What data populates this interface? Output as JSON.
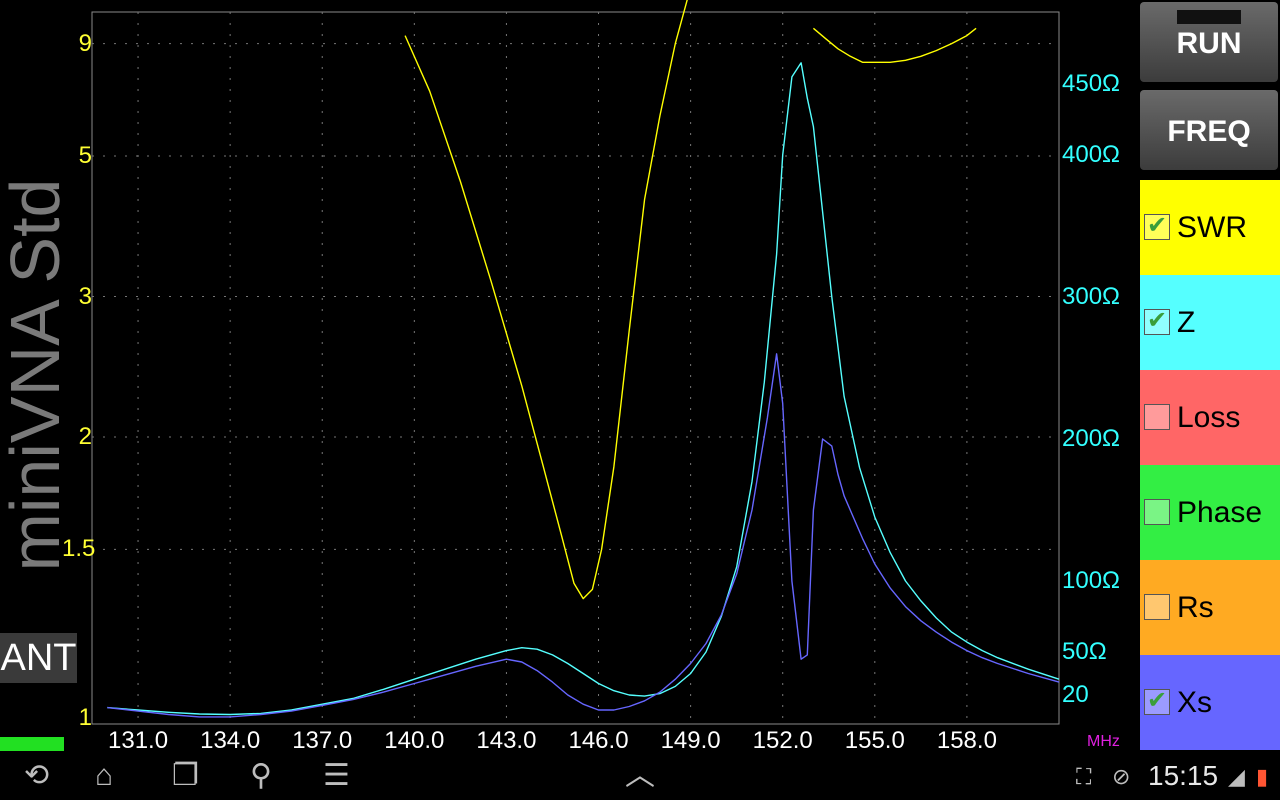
{
  "app_title": "miniVNA Std",
  "mode_label": "ANT",
  "buttons": {
    "run": "RUN",
    "freq": "FREQ"
  },
  "traces": [
    {
      "name": "SWR",
      "checked": true,
      "color": "#ffff00"
    },
    {
      "name": "Z",
      "checked": true,
      "color": "#55ffff"
    },
    {
      "name": "Loss",
      "checked": false,
      "color": "#ff6666"
    },
    {
      "name": "Phase",
      "checked": false,
      "color": "#33ee44"
    },
    {
      "name": "Rs",
      "checked": false,
      "color": "#ffaa22"
    },
    {
      "name": "Xs",
      "checked": true,
      "color": "#6666ff"
    }
  ],
  "status_bar": {
    "time": "15:15"
  },
  "chart_data": {
    "type": "line",
    "x_unit_label": "MHz",
    "xlim": [
      129.5,
      161.0
    ],
    "x_ticks": [
      "131.0",
      "134.0",
      "137.0",
      "140.0",
      "143.0",
      "146.0",
      "149.0",
      "152.0",
      "155.0",
      "158.0"
    ],
    "left_axis": {
      "scale": "swr",
      "ticks": [
        "9",
        "5",
        "3",
        "2",
        "1.5",
        "1"
      ],
      "color": "#ffff33"
    },
    "right_axis": {
      "ticks": [
        "450Ω",
        "400Ω",
        "300Ω",
        "200Ω",
        "100Ω",
        "50Ω",
        "20"
      ],
      "color": "#33ffff"
    },
    "grid": true,
    "series": [
      {
        "name": "SWR",
        "axis": "left",
        "color": "#ffff00",
        "x": [
          139.7,
          140.5,
          141.5,
          142.5,
          143.5,
          144.2,
          144.8,
          145.2,
          145.5,
          145.8,
          146.1,
          146.5,
          147.0,
          147.5,
          148.0,
          148.5,
          149.0,
          149.4,
          149.8,
          150.0
        ],
        "y": [
          9.5,
          6.8,
          4.5,
          3.15,
          2.3,
          1.85,
          1.55,
          1.38,
          1.33,
          1.36,
          1.5,
          1.85,
          2.7,
          4.2,
          6.0,
          9.0,
          14,
          22,
          40,
          60
        ]
      },
      {
        "name": "SWR",
        "axis": "left",
        "color": "#ffff00",
        "x": [
          153.0,
          153.4,
          153.8,
          154.2,
          154.6,
          155.0,
          155.5,
          156.0,
          156.5,
          157.0,
          157.5,
          158.0,
          158.3
        ],
        "y": [
          10,
          9.3,
          8.7,
          8.3,
          8.0,
          8.0,
          8.0,
          8.1,
          8.3,
          8.6,
          9.0,
          9.5,
          10
        ]
      },
      {
        "name": "Z",
        "axis": "right",
        "color": "#55ffff",
        "x": [
          130,
          131,
          132,
          133,
          134,
          135,
          136,
          137,
          138,
          139,
          140,
          141,
          142,
          143,
          143.5,
          144,
          144.5,
          145,
          145.5,
          146,
          146.5,
          147,
          147.5,
          148,
          148.5,
          149,
          149.5,
          150,
          150.5,
          151,
          151.4,
          151.8,
          152.0,
          152.3,
          152.6,
          152.8,
          153.0,
          153.3,
          153.6,
          154.0,
          154.5,
          155.0,
          155.5,
          156.0,
          156.5,
          157.0,
          157.5,
          158.0,
          158.5,
          159.0,
          160.0,
          161.0
        ],
        "y": [
          9,
          7,
          5,
          3.5,
          3,
          4,
          7,
          12,
          17,
          24,
          31,
          38,
          45,
          51,
          53,
          52,
          48,
          42,
          35,
          28,
          23,
          20,
          19,
          21,
          26,
          35,
          50,
          75,
          110,
          170,
          240,
          330,
          400,
          455,
          465,
          440,
          420,
          360,
          300,
          230,
          180,
          145,
          120,
          100,
          86,
          74,
          64,
          57,
          51,
          46,
          38,
          31
        ]
      },
      {
        "name": "Xs",
        "axis": "right",
        "color": "#6666ff",
        "x": [
          130,
          131,
          132,
          133,
          134,
          135,
          136,
          137,
          138,
          139,
          140,
          141,
          142,
          143,
          143.5,
          144,
          144.5,
          145,
          145.5,
          146,
          146.5,
          147,
          147.5,
          148,
          148.5,
          149,
          149.5,
          150,
          150.5,
          151,
          151.5,
          151.8,
          152.0,
          152.3,
          152.6,
          152.8,
          153.0,
          153.3,
          153.6,
          153.8,
          154.0,
          154.3,
          154.6,
          155.0,
          155.5,
          156.0,
          156.5,
          157.0,
          157.5,
          158.0,
          158.5,
          159.0,
          160.0,
          161.0
        ],
        "y": [
          9,
          6,
          3,
          1,
          1,
          3,
          6,
          11,
          16,
          22,
          28,
          34,
          40,
          45,
          43,
          37,
          29,
          20,
          12,
          7,
          7,
          10,
          15,
          22,
          31,
          42,
          56,
          76,
          105,
          150,
          215,
          260,
          225,
          100,
          45,
          48,
          150,
          200,
          195,
          175,
          160,
          145,
          130,
          112,
          95,
          82,
          72,
          64,
          57,
          51,
          46,
          42,
          35,
          29
        ]
      }
    ]
  }
}
